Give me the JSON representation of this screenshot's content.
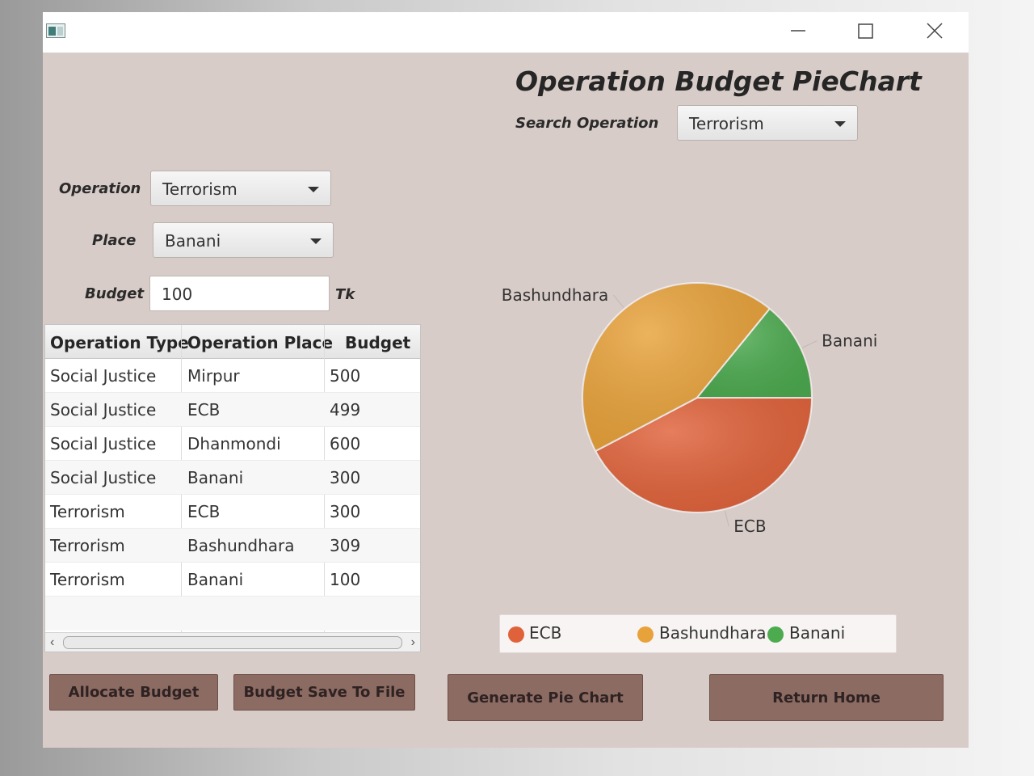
{
  "form": {
    "operation_label": "Operation",
    "operation_value": "Terrorism",
    "place_label": "Place",
    "place_value": "Banani",
    "budget_label": "Budget",
    "budget_value": "100",
    "budget_unit": "Tk"
  },
  "table": {
    "headers": [
      "Operation Type",
      "Operation Place",
      "Budget"
    ],
    "rows": [
      [
        "Social Justice",
        "Mirpur",
        "500"
      ],
      [
        "Social Justice",
        "ECB",
        "499"
      ],
      [
        "Social Justice",
        "Dhanmondi",
        "600"
      ],
      [
        "Social Justice",
        "Banani",
        "300"
      ],
      [
        "Terrorism",
        "ECB",
        "300"
      ],
      [
        "Terrorism",
        "Bashundhara",
        "309"
      ],
      [
        "Terrorism",
        "Banani",
        "100"
      ]
    ]
  },
  "chart_panel": {
    "title": "Operation Budget PieChart",
    "search_label": "Search Operation",
    "search_value": "Terrorism"
  },
  "buttons": {
    "allocate": "Allocate Budget",
    "save": "Budget Save To File",
    "generate": "Generate Pie Chart",
    "home": "Return Home"
  },
  "chart_data": {
    "type": "pie",
    "title": "Operation Budget PieChart",
    "labels": [
      "ECB",
      "Bashundhara",
      "Banani"
    ],
    "values": [
      300,
      309,
      100
    ],
    "colors": [
      "#e0623a",
      "#e8a23a",
      "#4caa4f"
    ],
    "legend_position": "bottom"
  }
}
